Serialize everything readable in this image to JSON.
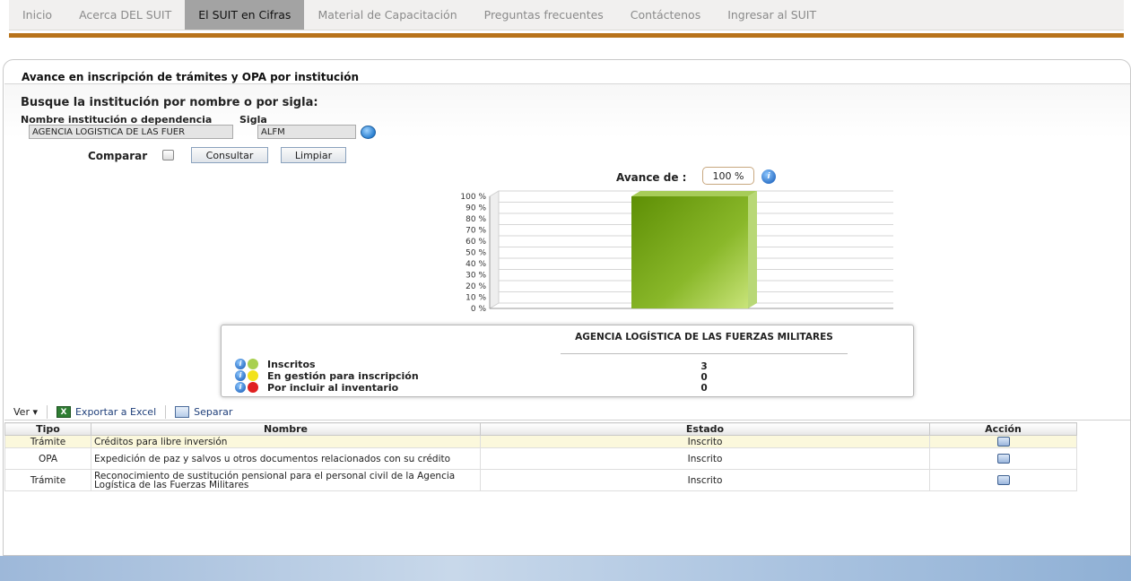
{
  "nav": {
    "items": [
      {
        "label": "Inicio"
      },
      {
        "label": "Acerca DEL SUIT"
      },
      {
        "label": "El SUIT en Cifras"
      },
      {
        "label": "Material de Capacitación"
      },
      {
        "label": "Preguntas frecuentes"
      },
      {
        "label": "Contáctenos"
      },
      {
        "label": "Ingresar al SUIT"
      }
    ],
    "active_index": 2,
    "brand_color": "#b8731b"
  },
  "panel": {
    "title": "Avance en inscripción de trámites y OPA por institución"
  },
  "search": {
    "title": "Busque la institución por nombre o por sigla:",
    "name_label": "Nombre institución o dependencia",
    "sigla_label": "Sigla",
    "name_value": "AGENCIA LOGÍSTICA DE LAS FUER",
    "sigla_value": "ALFM",
    "compare_label": "Comparar",
    "consultar_label": "Consultar",
    "limpiar_label": "Limpiar"
  },
  "avance": {
    "label": "Avance de :",
    "value": "100 %"
  },
  "chart_data": {
    "type": "bar",
    "categories": [
      "AGENCIA LOGÍSTICA DE LAS FUERZAS MILITARES"
    ],
    "values": [
      100
    ],
    "ylim": [
      0,
      100
    ],
    "yticks": [
      "0 %",
      "10 %",
      "20 %",
      "30 %",
      "40 %",
      "50 %",
      "60 %",
      "70 %",
      "80 %",
      "90 %",
      "100 %"
    ],
    "grid": true,
    "bar_color": "#8ab82a"
  },
  "summary": {
    "header": "AGENCIA LOGÍSTICA DE LAS FUERZAS MILITARES",
    "rows": [
      {
        "label": "Inscritos",
        "value": "3",
        "color": "#a8d050"
      },
      {
        "label": "En gestión para inscripción",
        "value": "0",
        "color": "#f2e21a"
      },
      {
        "label": "Por incluir al inventario",
        "value": "0",
        "color": "#e02020"
      }
    ]
  },
  "toolbar": {
    "view_label": "Ver ▾",
    "export_label": "Exportar a Excel",
    "detach_label": "Separar"
  },
  "table": {
    "headers": [
      "Tipo",
      "Nombre",
      "Estado",
      "Acción"
    ],
    "rows": [
      {
        "tipo": "Trámite",
        "nombre": "Créditos para libre inversión",
        "estado": "Inscrito"
      },
      {
        "tipo": "OPA",
        "nombre": "Expedición de paz y salvos u otros documentos relacionados con su crédito",
        "estado": "Inscrito"
      },
      {
        "tipo": "Trámite",
        "nombre": "Reconocimiento de sustitución pensional para el personal civil de la Agencia Logística de las Fuerzas Militares",
        "estado": "Inscrito"
      }
    ]
  }
}
